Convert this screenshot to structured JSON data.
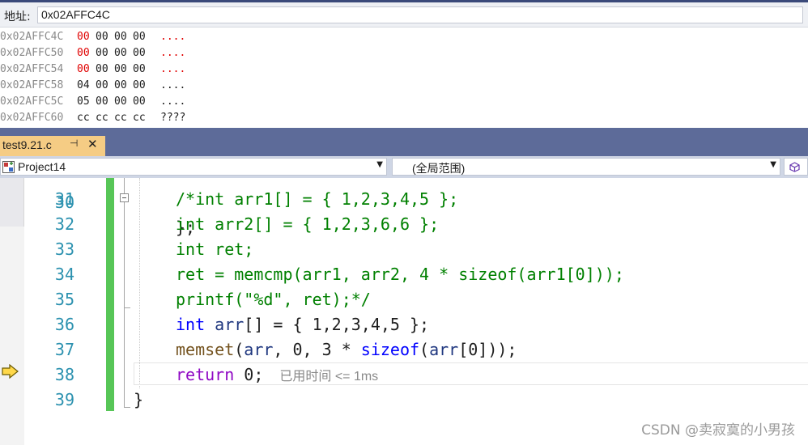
{
  "memory": {
    "address_label": "地址:",
    "address_value": "0x02AFFC4C",
    "rows": [
      {
        "addr": "0x02AFFC4C",
        "bytes": [
          "00",
          "00",
          "00",
          "00"
        ],
        "changed": [
          true,
          false,
          false,
          false
        ],
        "ascii": "...."
      },
      {
        "addr": "0x02AFFC50",
        "bytes": [
          "00",
          "00",
          "00",
          "00"
        ],
        "changed": [
          true,
          false,
          false,
          false
        ],
        "ascii": "...."
      },
      {
        "addr": "0x02AFFC54",
        "bytes": [
          "00",
          "00",
          "00",
          "00"
        ],
        "changed": [
          true,
          false,
          false,
          false
        ],
        "ascii": "...."
      },
      {
        "addr": "0x02AFFC58",
        "bytes": [
          "04",
          "00",
          "00",
          "00"
        ],
        "changed": [
          false,
          false,
          false,
          false
        ],
        "ascii": "...."
      },
      {
        "addr": "0x02AFFC5C",
        "bytes": [
          "05",
          "00",
          "00",
          "00"
        ],
        "changed": [
          false,
          false,
          false,
          false
        ],
        "ascii": "...."
      },
      {
        "addr": "0x02AFFC60",
        "bytes": [
          "cc",
          "cc",
          "cc",
          "cc"
        ],
        "changed": [
          false,
          false,
          false,
          false
        ],
        "ascii": "????"
      }
    ]
  },
  "tab": {
    "title": "test9.21.c",
    "pin_icon": "⊣",
    "close_icon": "✕"
  },
  "navbar": {
    "project": "Project14",
    "scope": "(全局范围)"
  },
  "editor": {
    "lines": [
      {
        "num": "31",
        "tokens": [
          {
            "t": "/*int arr1[] = { 1,2,3,4,5 };",
            "c": "cmt"
          }
        ]
      },
      {
        "num": "32",
        "tokens": [
          {
            "t": "int arr2[] = { 1,2,3,6,6 };",
            "c": "cmt"
          }
        ]
      },
      {
        "num": "33",
        "tokens": [
          {
            "t": "int ret;",
            "c": "cmt"
          }
        ]
      },
      {
        "num": "34",
        "tokens": [
          {
            "t": "ret = memcmp(arr1, arr2, 4 * sizeof(arr1[0]));",
            "c": "cmt"
          }
        ]
      },
      {
        "num": "35",
        "tokens": [
          {
            "t": "printf(\"%d\", ret);*/",
            "c": "cmt"
          }
        ]
      },
      {
        "num": "36",
        "tokens": [
          {
            "t": "int",
            "c": "kw"
          },
          {
            "t": " ",
            "c": "txt"
          },
          {
            "t": "arr",
            "c": "id"
          },
          {
            "t": "[] = { 1,2,3,4,5 };",
            "c": "txt"
          }
        ]
      },
      {
        "num": "37",
        "tokens": [
          {
            "t": "memset",
            "c": "fn"
          },
          {
            "t": "(",
            "c": "txt"
          },
          {
            "t": "arr",
            "c": "id"
          },
          {
            "t": ", 0, 3 * ",
            "c": "txt"
          },
          {
            "t": "sizeof",
            "c": "kw"
          },
          {
            "t": "(",
            "c": "txt"
          },
          {
            "t": "arr",
            "c": "id"
          },
          {
            "t": "[0]));",
            "c": "txt"
          }
        ]
      },
      {
        "num": "38",
        "tokens": [
          {
            "t": "return",
            "c": "kw2"
          },
          {
            "t": " 0;",
            "c": "txt"
          }
        ],
        "hint": "已用时间 <= 1ms"
      },
      {
        "num": "39",
        "tokens": [
          {
            "t": "}",
            "c": "txt"
          }
        ]
      }
    ],
    "partial_top_line": {
      "num": "30",
      "text": "};"
    }
  },
  "watermark": "CSDN @卖寂寞的小男孩",
  "colors": {
    "changed_byte": "#e00000",
    "tab_active": "#f5cc84",
    "tab_bar": "#5d6b99",
    "change_bar": "#57c657"
  }
}
